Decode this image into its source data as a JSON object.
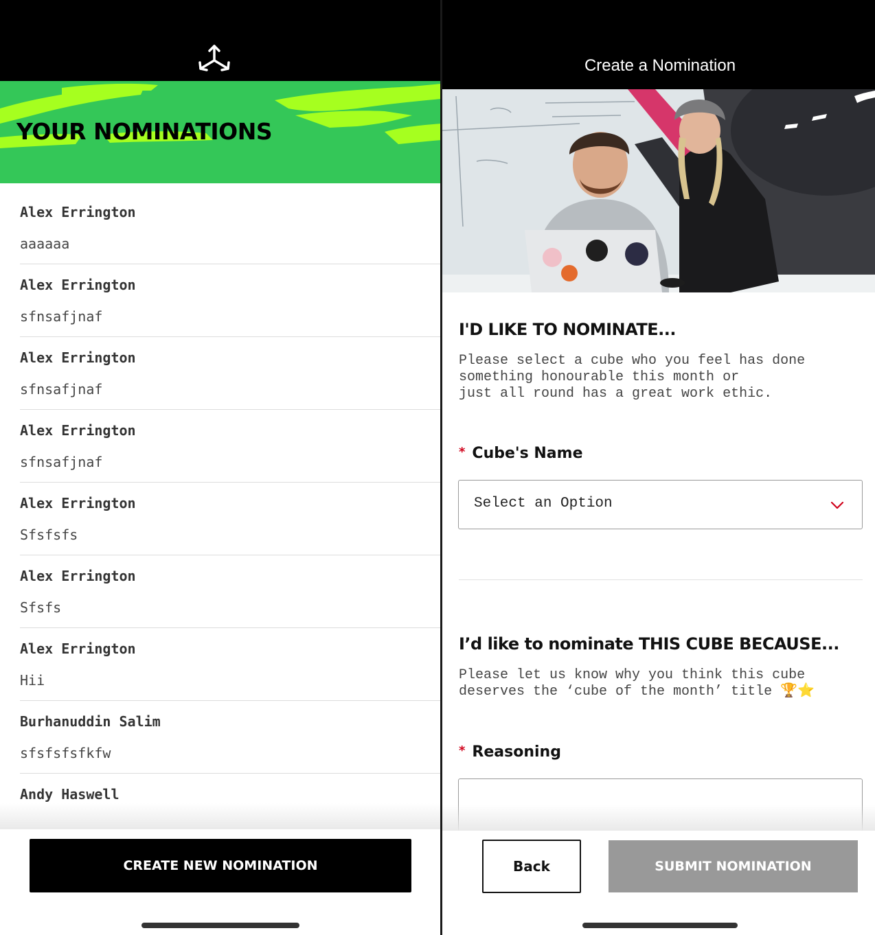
{
  "left": {
    "banner_title": "YOUR NOMINATIONS",
    "nominations": [
      {
        "name": "Alex Errington",
        "reason": "aaaaaa"
      },
      {
        "name": "Alex Errington",
        "reason": "sfnsafjnaf"
      },
      {
        "name": "Alex Errington",
        "reason": "sfnsafjnaf"
      },
      {
        "name": "Alex Errington",
        "reason": "sfnsafjnaf"
      },
      {
        "name": "Alex Errington",
        "reason": "Sfsfsfs"
      },
      {
        "name": "Alex Errington",
        "reason": "Sfsfs"
      },
      {
        "name": "Alex Errington",
        "reason": "Hii"
      },
      {
        "name": "Burhanuddin Salim",
        "reason": "sfsfsfsfkfw"
      },
      {
        "name": "Andy Haswell",
        "reason": ""
      }
    ],
    "create_button": "CREATE NEW NOMINATION",
    "colors": {
      "banner_green": "#34c758",
      "splash_lime": "#a6ff1f",
      "topbar": "#000000"
    }
  },
  "right": {
    "header_title": "Create a Nomination",
    "section1": {
      "title": "I'D LIKE TO NOMINATE...",
      "description": "Please select a cube who you feel has done\nsomething honourable this month or\njust all round has a great work ethic."
    },
    "cube_name_field": {
      "required_mark": "*",
      "label": "Cube's Name",
      "selected_value": "Select an Option"
    },
    "section2": {
      "title": "I’d like to nominate THIS CUBE BECAUSE...",
      "description": "Please let us know why you think this cube\ndeserves the ‘cube of the month’ title 🏆⭐"
    },
    "reasoning_field": {
      "required_mark": "*",
      "label": "Reasoning",
      "value": ""
    },
    "back_button": "Back",
    "submit_button": "SUBMIT NOMINATION",
    "colors": {
      "required": "#d0021b",
      "chevron": "#d0021b",
      "submit_disabled": "#999999"
    }
  }
}
